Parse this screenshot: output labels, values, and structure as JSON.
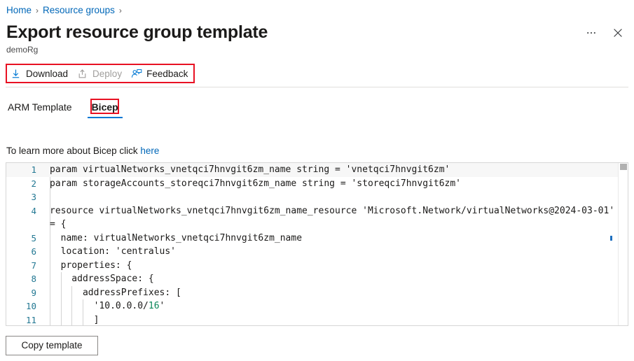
{
  "breadcrumb": {
    "items": [
      {
        "label": "Home"
      },
      {
        "label": "Resource groups"
      }
    ],
    "separator": "›"
  },
  "header": {
    "title": "Export resource group template",
    "subtitle": "demoRg",
    "more_icon": "ellipsis-icon",
    "close_icon": "close-icon"
  },
  "commandbar": {
    "download": {
      "label": "Download",
      "icon": "download-icon",
      "enabled": true
    },
    "deploy": {
      "label": "Deploy",
      "icon": "upload-icon",
      "enabled": false
    },
    "feedback": {
      "label": "Feedback",
      "icon": "person-feedback-icon",
      "enabled": true
    },
    "highlight_color": "#e81123"
  },
  "tabs": {
    "items": [
      {
        "label": "ARM Template",
        "selected": false
      },
      {
        "label": "Bicep",
        "selected": true
      }
    ],
    "selected_underline_color": "#0078d4",
    "highlight_color": "#e81123"
  },
  "learn_more": {
    "text_before": "To learn more about Bicep click ",
    "link_label": "here",
    "link_color": "#0067b8"
  },
  "editor": {
    "language": "bicep",
    "line_number_color": "#237893",
    "lines": [
      {
        "number": "1",
        "text": "param virtualNetworks_vnetqci7hnvgit6zm_name string = 'vnetqci7hnvgit6zm'",
        "current": true
      },
      {
        "number": "2",
        "text": "param storageAccounts_storeqci7hnvgit6zm_name string = 'storeqci7hnvgit6zm'",
        "current": false
      },
      {
        "number": "3",
        "text": "",
        "current": false
      },
      {
        "number": "4",
        "text": "resource virtualNetworks_vnetqci7hnvgit6zm_name_resource 'Microsoft.Network/virtualNetworks@2024-03-01'",
        "current": false
      },
      {
        "number": "",
        "text": "= {",
        "current": false
      },
      {
        "number": "5",
        "text": "  name: virtualNetworks_vnetqci7hnvgit6zm_name",
        "current": false
      },
      {
        "number": "6",
        "text": "  location: 'centralus'",
        "current": false
      },
      {
        "number": "7",
        "text": "  properties: {",
        "current": false
      },
      {
        "number": "8",
        "text": "    addressSpace: {",
        "current": false
      },
      {
        "number": "9",
        "text": "      addressPrefixes: [",
        "current": false
      },
      {
        "number": "10",
        "text": "        '10.0.0.0/16'",
        "current": false,
        "num_token": "16"
      },
      {
        "number": "11",
        "text": "        ]",
        "current": false
      }
    ]
  },
  "footer": {
    "copy_label": "Copy template"
  }
}
